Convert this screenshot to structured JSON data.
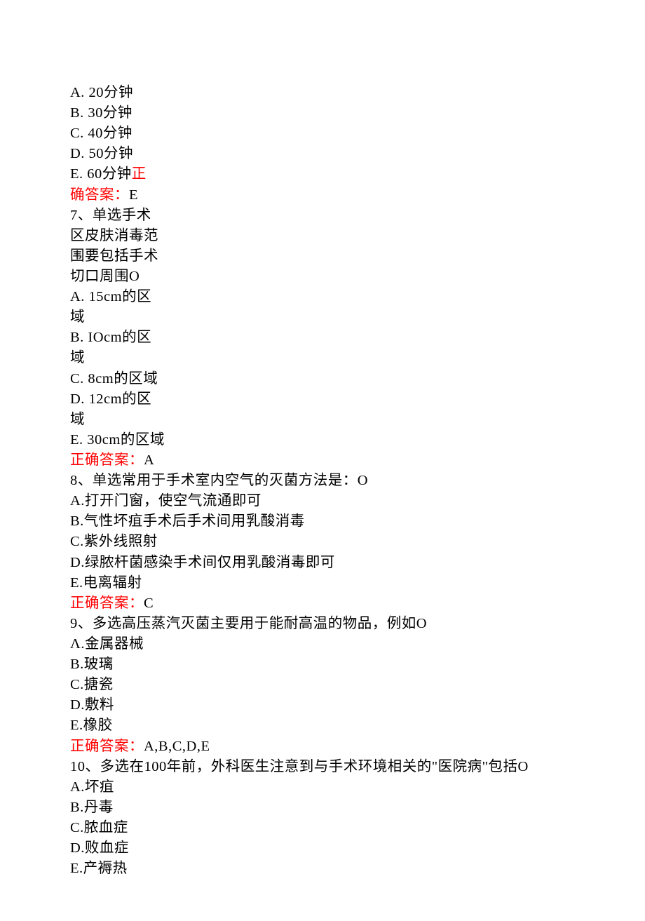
{
  "q6": {
    "optA": "A. 20分钟",
    "optB": "B. 30分钟",
    "optC": "C. 40分钟",
    "optD": "D. 50分钟",
    "optE_prefix": "E. 60分钟",
    "optE_red_tail": "正",
    "answer_prefix": "确答案：",
    "answer_letter": "E"
  },
  "q7": {
    "stem_l1": "7、单选手术",
    "stem_l2": "区皮肤消毒范",
    "stem_l3": "围要包括手术",
    "stem_l4": "切口周围O",
    "optA_l1": "A. 15cm的区",
    "optA_l2": "域",
    "optB_l1": "B. IOcm的区",
    "optB_l2": "域",
    "optC": "C. 8cm的区域",
    "optD_l1": "D. 12cm的区",
    "optD_l2": "域",
    "optE": "E. 30cm的区域",
    "answer_label": "正确答案：",
    "answer_letter": "A"
  },
  "q8": {
    "stem": "8、单选常用于手术室内空气的灭菌方法是：O",
    "optA": "A.打开门窗，使空气流通即可",
    "optB": "B.气性坏疽手术后手术间用乳酸消毒",
    "optC": "C.紫外线照射",
    "optD": "D.绿脓杆菌感染手术间仅用乳酸消毒即可",
    "optE": "E.电离辐射",
    "answer_label": "正确答案：",
    "answer_letter": "C"
  },
  "q9": {
    "stem": "9、多选高压蒸汽灭菌主要用于能耐高温的物品，例如O",
    "optA": "Λ.金属器械",
    "optB": "B.玻璃",
    "optC": "C.搪瓷",
    "optD": "D.敷料",
    "optE": "E.橡胶",
    "answer_label": "正确答案：",
    "answer_letter": "A,B,C,D,E"
  },
  "q10": {
    "stem": "10、多选在100年前，外科医生注意到与手术环境相关的\"医院病\"包括O",
    "optA": "A.坏疽",
    "optB": "B.丹毒",
    "optC": "C.脓血症",
    "optD": "D.败血症",
    "optE": "E.产褥热"
  }
}
